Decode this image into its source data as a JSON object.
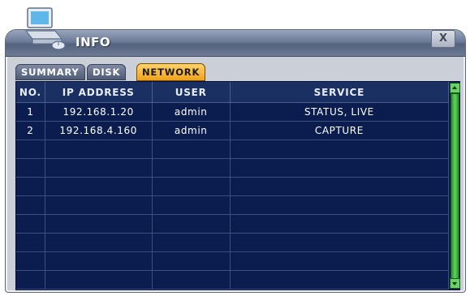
{
  "window": {
    "title": "INFO",
    "close_label": "X"
  },
  "tabs": [
    {
      "label": "SUMMARY",
      "active": false
    },
    {
      "label": "DISK",
      "active": false
    },
    {
      "label": "NETWORK",
      "active": true
    }
  ],
  "table": {
    "headers": [
      "NO.",
      "IP ADDRESS",
      "USER",
      "SERVICE"
    ],
    "rows": [
      [
        "1",
        "192.168.1.20",
        "admin",
        "STATUS, LIVE"
      ],
      [
        "2",
        "192.168.4.160",
        "admin",
        "CAPTURE"
      ],
      [
        "",
        "",
        "",
        ""
      ],
      [
        "",
        "",
        "",
        ""
      ],
      [
        "",
        "",
        "",
        ""
      ],
      [
        "",
        "",
        "",
        ""
      ],
      [
        "",
        "",
        "",
        ""
      ],
      [
        "",
        "",
        "",
        ""
      ],
      [
        "",
        "",
        "",
        ""
      ],
      [
        "",
        "",
        "",
        ""
      ]
    ]
  },
  "colors": {
    "active_tab": "#f0a21a",
    "grid_bg": "#0b1d4e",
    "scrollbar": "#5fd45f"
  },
  "icons": {
    "app": "computer-icon",
    "close": "close-icon"
  }
}
